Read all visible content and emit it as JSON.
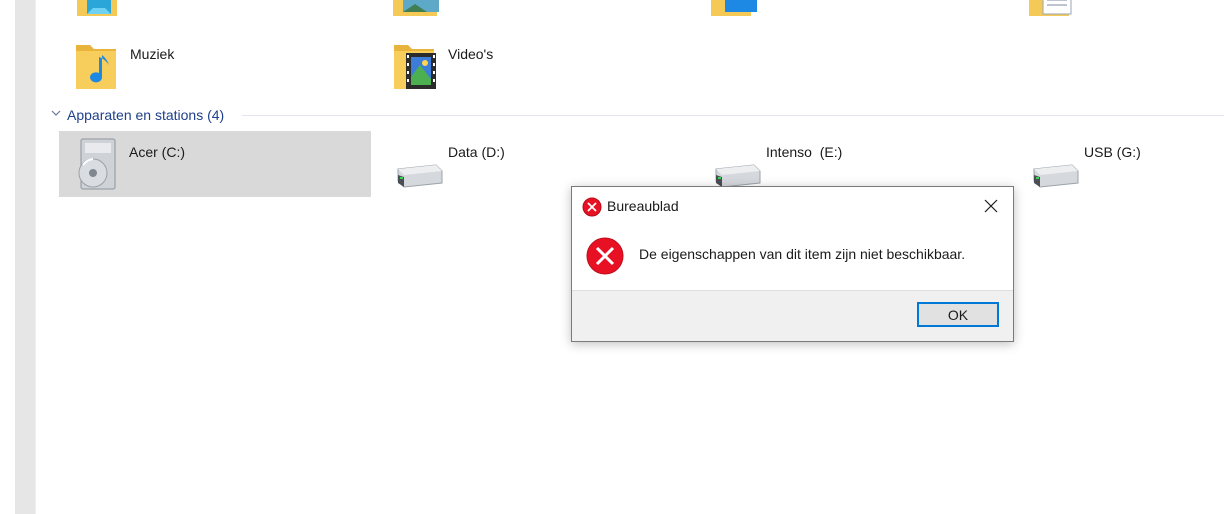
{
  "explorer": {
    "top_row_partial": [
      {
        "icon": "3d-objects-folder-icon"
      },
      {
        "icon": "pictures-folder-icon"
      },
      {
        "icon": "desktop-folder-icon"
      },
      {
        "icon": "documents-folder-icon"
      }
    ],
    "folders": [
      {
        "label": "Muziek",
        "icon": "music-folder-icon"
      },
      {
        "label": "Video's",
        "icon": "videos-folder-icon"
      }
    ],
    "group_header": "Apparaten en stations (4)",
    "drives": [
      {
        "label": "Acer (C:)",
        "icon": "system-drive-icon",
        "selected": true
      },
      {
        "label": "Data (D:)",
        "icon": "hard-drive-icon"
      },
      {
        "label": "Intenso  (E:)",
        "icon": "hard-drive-icon"
      },
      {
        "label": "USB (G:)",
        "icon": "hard-drive-icon"
      }
    ]
  },
  "dialog": {
    "title": "Bureaublad",
    "message": "De eigenschappen van dit item zijn niet beschikbaar.",
    "ok_label": "OK",
    "icon": "error-icon",
    "close_icon": "close-icon"
  },
  "colors": {
    "group_header": "#1e3f8a",
    "error_red": "#e81123",
    "selection": "#d9d9d9",
    "button_focus": "#0078d7"
  }
}
